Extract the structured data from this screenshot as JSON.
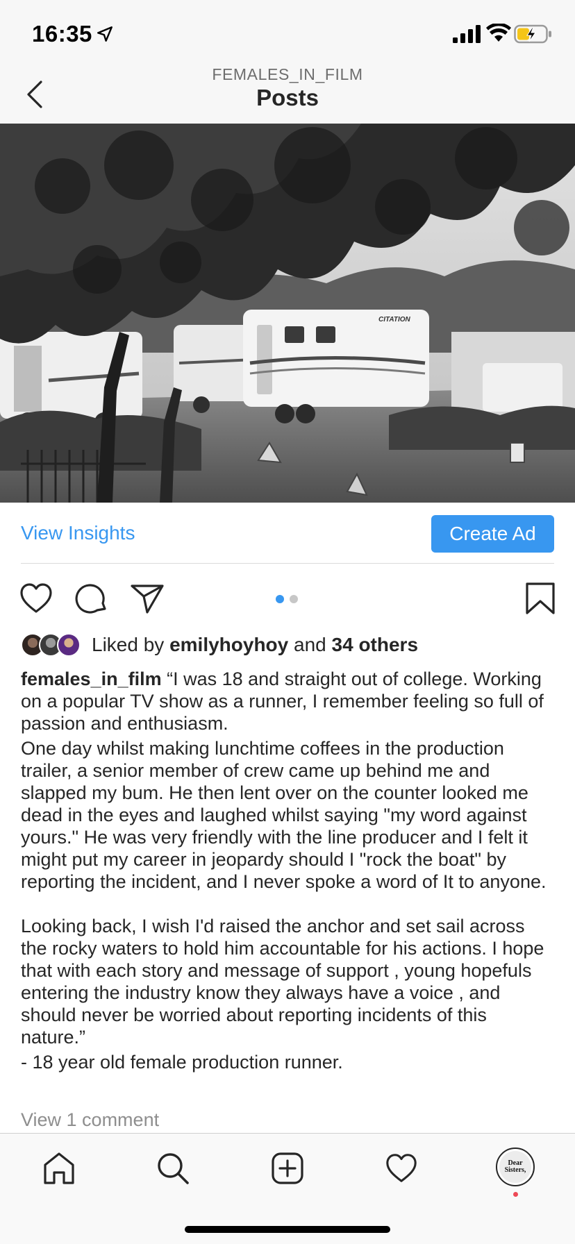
{
  "status_bar": {
    "time": "16:35",
    "icons": [
      "location-arrow-icon",
      "cellular-signal-icon",
      "wifi-icon",
      "battery-charging-icon"
    ],
    "battery_color": "#f5c518"
  },
  "header": {
    "account": "FEMALES_IN_FILM",
    "title": "Posts"
  },
  "post": {
    "image_description": "black-and-white-photo-of-trailers",
    "insights_label": "View Insights",
    "create_ad_label": "Create Ad",
    "carousel": {
      "count": 2,
      "active": 1
    },
    "likes": {
      "prefix": "Liked by",
      "user": "emilyhoyhoy",
      "conj": "and",
      "others": "34 others"
    },
    "caption": {
      "username": "females_in_film",
      "p1": " “I was 18 and straight out of college. Working on a popular TV show as a runner, I remember feeling so full of passion and enthusiasm.",
      "p2": "One day whilst making lunchtime coffees in the production trailer, a senior member of crew came up behind me and slapped my bum. He then lent over on the counter looked me dead in the eyes and laughed whilst saying \"my word against yours.\" He was very friendly with the line producer and I felt it might put my career in jeopardy should I \"rock the boat\" by reporting the incident, and I never spoke a word of It to anyone.",
      "p3": "Looking back, I wish I'd raised the anchor and set sail across the rocky waters to hold him accountable for his actions. I hope that with each story and message of support , young hopefuls entering the industry know they always have a voice , and should never be worried about reporting incidents of this nature.”",
      "p4": "- 18 year old female production runner."
    },
    "view_comments": "View 1 comment"
  },
  "tab_bar": {
    "items": [
      "home-icon",
      "search-icon",
      "new-post-icon",
      "activity-heart-icon",
      "profile-avatar"
    ],
    "profile_avatar_text": "Dear Sisters,"
  },
  "colors": {
    "accent": "#3897f0",
    "text": "#262626",
    "muted": "#8e8e8e",
    "notification": "#ed4956"
  }
}
